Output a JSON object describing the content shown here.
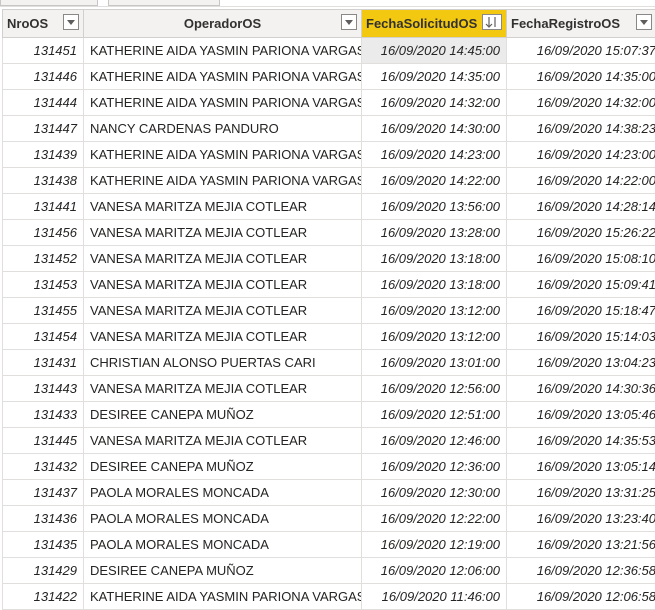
{
  "table": {
    "columns": [
      {
        "label": "NroOS"
      },
      {
        "label": "OperadorOS"
      },
      {
        "label": "FechaSolicitudOS",
        "sort": "descending"
      },
      {
        "label": "FechaRegistroOS"
      }
    ],
    "rows": [
      [
        "131451",
        "KATHERINE AIDA YASMIN PARIONA VARGAS",
        "16/09/2020 14:45:00",
        "16/09/2020 15:07:37"
      ],
      [
        "131446",
        "KATHERINE AIDA YASMIN PARIONA VARGAS",
        "16/09/2020 14:35:00",
        "16/09/2020 14:35:00"
      ],
      [
        "131444",
        "KATHERINE AIDA YASMIN PARIONA VARGAS",
        "16/09/2020 14:32:00",
        "16/09/2020 14:32:00"
      ],
      [
        "131447",
        "NANCY CARDENAS PANDURO",
        "16/09/2020 14:30:00",
        "16/09/2020 14:38:23"
      ],
      [
        "131439",
        "KATHERINE AIDA YASMIN PARIONA VARGAS",
        "16/09/2020 14:23:00",
        "16/09/2020 14:23:00"
      ],
      [
        "131438",
        "KATHERINE AIDA YASMIN PARIONA VARGAS",
        "16/09/2020 14:22:00",
        "16/09/2020 14:22:00"
      ],
      [
        "131441",
        "VANESA MARITZA MEJIA COTLEAR",
        "16/09/2020 13:56:00",
        "16/09/2020 14:28:14"
      ],
      [
        "131456",
        "VANESA MARITZA MEJIA COTLEAR",
        "16/09/2020 13:28:00",
        "16/09/2020 15:26:22"
      ],
      [
        "131452",
        "VANESA MARITZA MEJIA COTLEAR",
        "16/09/2020 13:18:00",
        "16/09/2020 15:08:10"
      ],
      [
        "131453",
        "VANESA MARITZA MEJIA COTLEAR",
        "16/09/2020 13:18:00",
        "16/09/2020 15:09:41"
      ],
      [
        "131455",
        "VANESA MARITZA MEJIA COTLEAR",
        "16/09/2020 13:12:00",
        "16/09/2020 15:18:47"
      ],
      [
        "131454",
        "VANESA MARITZA MEJIA COTLEAR",
        "16/09/2020 13:12:00",
        "16/09/2020 15:14:03"
      ],
      [
        "131431",
        "CHRISTIAN ALONSO PUERTAS CARI",
        "16/09/2020 13:01:00",
        "16/09/2020 13:04:23"
      ],
      [
        "131443",
        "VANESA MARITZA MEJIA COTLEAR",
        "16/09/2020 12:56:00",
        "16/09/2020 14:30:36"
      ],
      [
        "131433",
        "DESIREE CANEPA MUÑOZ",
        "16/09/2020 12:51:00",
        "16/09/2020 13:05:46"
      ],
      [
        "131445",
        "VANESA MARITZA MEJIA COTLEAR",
        "16/09/2020 12:46:00",
        "16/09/2020 14:35:53"
      ],
      [
        "131432",
        "DESIREE CANEPA MUÑOZ",
        "16/09/2020 12:36:00",
        "16/09/2020 13:05:14"
      ],
      [
        "131437",
        "PAOLA MORALES MONCADA",
        "16/09/2020 12:30:00",
        "16/09/2020 13:31:25"
      ],
      [
        "131436",
        "PAOLA MORALES MONCADA",
        "16/09/2020 12:22:00",
        "16/09/2020 13:23:40"
      ],
      [
        "131435",
        "PAOLA MORALES MONCADA",
        "16/09/2020 12:19:00",
        "16/09/2020 13:21:56"
      ],
      [
        "131429",
        "DESIREE CANEPA MUÑOZ",
        "16/09/2020 12:06:00",
        "16/09/2020 12:36:58"
      ],
      [
        "131422",
        "KATHERINE AIDA YASMIN PARIONA VARGAS",
        "16/09/2020 11:46:00",
        "16/09/2020 12:06:58"
      ]
    ]
  },
  "colors": {
    "header_bg": "#f3f2f1",
    "sorted_header_bg": "#f2c811",
    "selected_cell_bg": "#ebebeb",
    "gridline": "#e1dfdd"
  },
  "icons": {
    "filter": "chevron-down-icon",
    "sort": "sort-descending-icon"
  }
}
